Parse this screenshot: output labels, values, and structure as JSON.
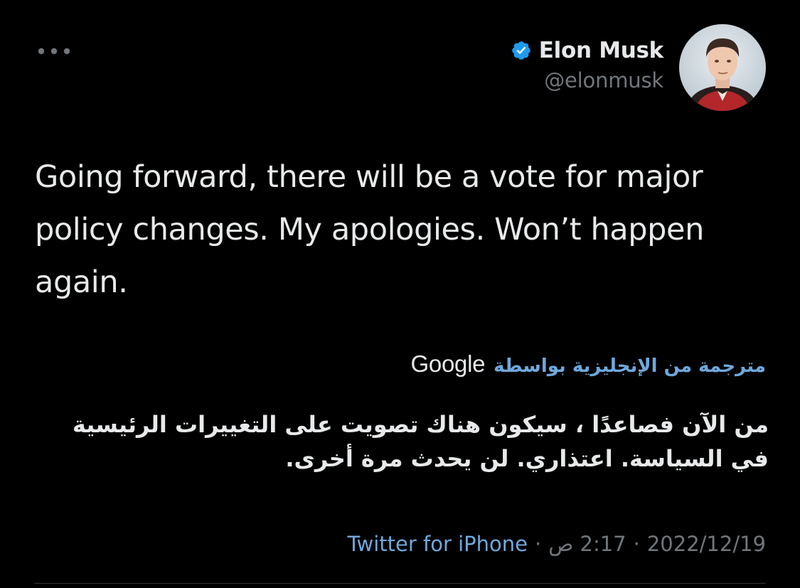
{
  "tweet": {
    "author": {
      "display_name": "Elon Musk",
      "handle": "@elonmusk",
      "verified": true
    },
    "text": "Going forward, there will be a vote for major policy changes. My apologies. Won’t happen again.",
    "translation": {
      "label": "مترجمة من الإنجليزية بواسطة",
      "provider": "Google",
      "text": "من الآن فصاعدًا ، سيكون هناك تصويت على التغييرات الرئيسية في السياسة. اعتذاري. لن يحدث مرة أخرى."
    },
    "meta": {
      "date": "2022/12/19",
      "time": "2:17 ص",
      "separator": "·",
      "source": "Twitter for iPhone"
    }
  },
  "icons": {
    "more": "more-horizontal-icon",
    "verified": "verified-badge-icon"
  },
  "colors": {
    "background": "#000000",
    "text": "#e7e9ea",
    "secondary": "#71767b",
    "link": "#6fa8dc",
    "verified": "#1d9bf0"
  }
}
